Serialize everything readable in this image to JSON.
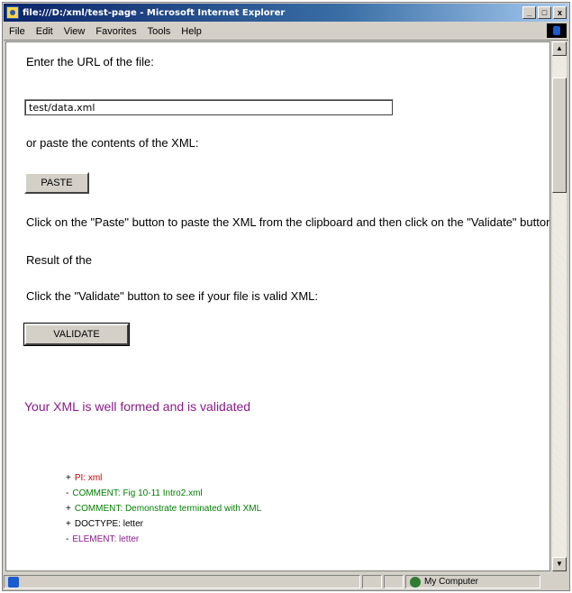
{
  "window": {
    "title": "file:///D:/xml/test-page - Microsoft Internet Explorer",
    "controls": {
      "minimize": "_",
      "maximize": "□",
      "close": "x"
    }
  },
  "menubar": {
    "items": [
      "File",
      "Edit",
      "View",
      "Favorites",
      "Tools",
      "Help"
    ]
  },
  "page": {
    "prompt_url": "Enter the URL of the file:",
    "url_value": "test/data.xml",
    "prompt_paste": "or paste the contents of the XML:",
    "paste_button": "PASTE",
    "instructions": "Click on the \"Paste\" button to paste the XML from the clipboard and then click on the \"Validate\" button.",
    "result_label": "Result of the",
    "validate_prompt": "Click the \"Validate\" button to see if your file is valid XML:",
    "validate_button": "VALIDATE",
    "result_message": "Your XML is well formed and is validated",
    "tree": [
      {
        "marker": "+",
        "text": "PI: xml",
        "kind": "pi"
      },
      {
        "marker": "-",
        "text": "COMMENT: Fig 10-11 Intro2.xml",
        "kind": "comment"
      },
      {
        "marker": "+",
        "text": "COMMENT: Demonstrate terminated with XML",
        "kind": "comment"
      },
      {
        "marker": "+",
        "text": "DOCTYPE: letter",
        "kind": "doctype"
      },
      {
        "marker": "-",
        "text": "ELEMENT: letter",
        "kind": "element"
      }
    ]
  },
  "statusbar": {
    "zone": "My Computer"
  },
  "colors": {
    "titlebar": "#0a246a",
    "result": "#8b1a8b",
    "pi": "#c00000",
    "comment": "#007f00",
    "element": "#8b1a8b"
  }
}
